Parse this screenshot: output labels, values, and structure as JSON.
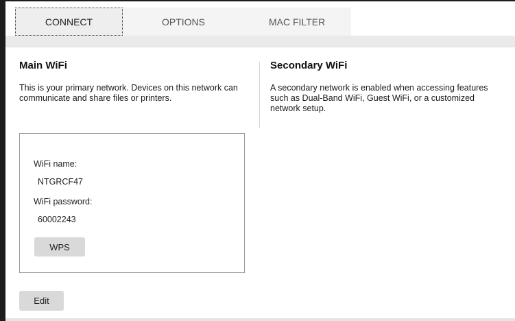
{
  "tabs": [
    {
      "label": "CONNECT",
      "active": true
    },
    {
      "label": "OPTIONS",
      "active": false
    },
    {
      "label": "MAC FILTER",
      "active": false
    }
  ],
  "main_wifi": {
    "title": "Main WiFi",
    "description": "This is your primary network. Devices on this network can communicate and share files or printers.",
    "name_label": "WiFi name:",
    "name_value": "NTGRCF47",
    "password_label": "WiFi password:",
    "password_value": "60002243",
    "wps_label": "WPS"
  },
  "secondary_wifi": {
    "title": "Secondary WiFi",
    "description": "A secondary network is enabled when accessing features such as Dual-Band WiFi, Guest WiFi, or a customized network setup."
  },
  "edit_label": "Edit",
  "colors": {
    "button_bg": "#d9d9d9",
    "tab_active_bg": "#eeeeee",
    "border": "#1c1c1c"
  }
}
